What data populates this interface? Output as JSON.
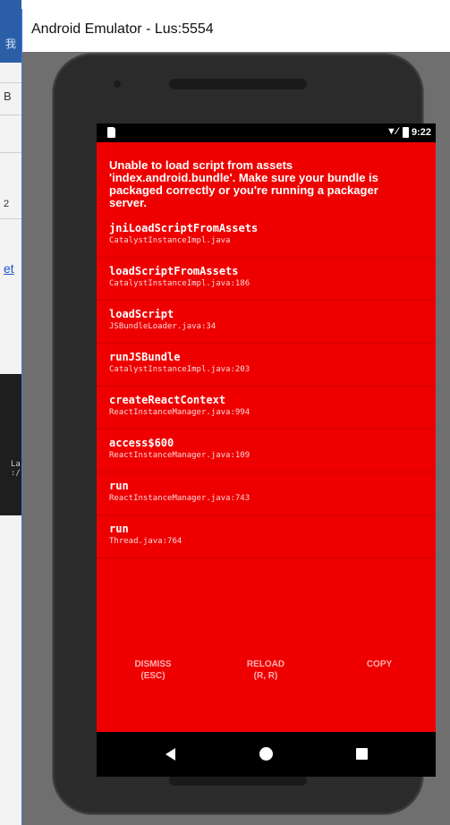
{
  "background": {
    "title_fragment": "我",
    "text_b": "B",
    "text_2": "2",
    "link_text": "et",
    "terminal_text": "La\n:/"
  },
  "window": {
    "title": "Android Emulator - Lus:5554"
  },
  "status_bar": {
    "signal": "▼⁄",
    "time": "9:22"
  },
  "error": {
    "message": "Unable to load script from assets 'index.android.bundle'. Make sure your bundle is packaged correctly or you're running a packager server.",
    "stack": [
      {
        "method": "jniLoadScriptFromAssets",
        "location": "CatalystInstanceImpl.java"
      },
      {
        "method": "loadScriptFromAssets",
        "location": "CatalystInstanceImpl.java:186"
      },
      {
        "method": "loadScript",
        "location": "JSBundleLoader.java:34"
      },
      {
        "method": "runJSBundle",
        "location": "CatalystInstanceImpl.java:203"
      },
      {
        "method": "createReactContext",
        "location": "ReactInstanceManager.java:994"
      },
      {
        "method": "access$600",
        "location": "ReactInstanceManager.java:109"
      },
      {
        "method": "run",
        "location": "ReactInstanceManager.java:743"
      },
      {
        "method": "run",
        "location": "Thread.java:764"
      }
    ]
  },
  "actions": {
    "dismiss": "DISMISS\n(ESC)",
    "reload": "RELOAD\n(R, R)",
    "copy": "COPY"
  },
  "colors": {
    "error_background": "#ee0000",
    "window_background": "#6f6f6f",
    "phone_body": "#2b2b2b"
  },
  "icons": {
    "back": "back-triangle-icon",
    "home": "home-circle-icon",
    "recents": "recents-square-icon"
  }
}
